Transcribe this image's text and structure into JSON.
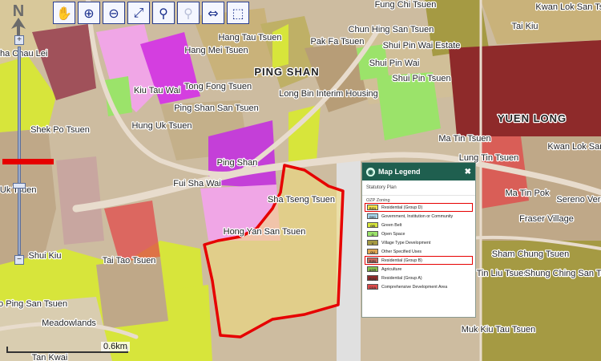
{
  "map": {
    "labels": [
      "Sha Chau Lei",
      "Shek Po Tsuen",
      "Lee Uk Tsuen",
      "Kiu Tau Wai",
      "Hung Uk Tsuen",
      "Hang Mei Tsuen",
      "Hang Tau Tsuen",
      "Pak Fa Tsuen",
      "PING SHAN",
      "Tong Fong Tsuen",
      "Ping Shan San Tsuen",
      "Long Bin Interim Housing",
      "Ping Shan",
      "Fui Sha Wai",
      "Sha Tseng Tsuen",
      "Hong Yan San Tsuen",
      "Tai Tao Tsuen",
      "Shui Kiu",
      "Wo Ping San Tsuen",
      "Meadowlands",
      "Tan Kwai",
      "Fung Chi Tsuen",
      "Chun Hing San Tsuen",
      "Shui Pin Wai Estate",
      "Tai Kiu",
      "Kwan Lok San Tsuen",
      "Shui Pin Wai",
      "Shui Pin Tsuen",
      "YUEN LONG",
      "Kwan Lok San Tsuen",
      "Ma Tin Tsuen",
      "Lung Tin Tsuen",
      "Ma Tin Pok",
      "Sereno Verde",
      "Fraser Village",
      "Sham Chung Tsuen",
      "Tin Liu Tsuen",
      "Shung Ching San Tsuen",
      "Muk Kiu Tau Tsuen"
    ],
    "scale_label": "0.6km",
    "north_label": "N",
    "zoom_plus": "+",
    "zoom_minus": "−"
  },
  "toolbar": {
    "tools": [
      "pan-icon",
      "zoom-in-icon",
      "zoom-out-icon",
      "full-extent-icon",
      "identify-icon",
      "magnify-icon",
      "swipe-icon",
      "select-icon"
    ],
    "glyphs": [
      "✋",
      "⊕",
      "⊖",
      "⤢",
      "⚲",
      "⚲",
      "⇔",
      "⬚"
    ]
  },
  "legend": {
    "title": "Map Legend",
    "close": "✖",
    "subtitle": "Statutory Plan",
    "category": "OZP Zoning",
    "items": [
      {
        "code": "R(D)",
        "label": "Residential (Group D)",
        "color": "#f7e34a",
        "highlighted": true
      },
      {
        "code": "G/IC",
        "label": "Government, Institution or Community",
        "color": "#a9d7ee",
        "highlighted": false
      },
      {
        "code": "GB",
        "label": "Green Belt",
        "color": "#d7e53b",
        "highlighted": false
      },
      {
        "code": "O",
        "label": "Open Space",
        "color": "#9be36a",
        "highlighted": false
      },
      {
        "code": "V",
        "label": "Village Type Development",
        "color": "#a59a43",
        "highlighted": false
      },
      {
        "code": "OU",
        "label": "Other Specified Uses",
        "color": "#e0a64f",
        "highlighted": false
      },
      {
        "code": "R(B)",
        "label": "Residential (Group B)",
        "color": "#c96b5c",
        "highlighted": true
      },
      {
        "code": "AGR",
        "label": "Agriculture",
        "color": "#86c14a",
        "highlighted": false
      },
      {
        "code": "R(A)",
        "label": "Residential (Group A)",
        "color": "#8e2a2a",
        "highlighted": false
      },
      {
        "code": "CDA",
        "label": "Comprehensive Development Area",
        "color": "#e04b4b",
        "highlighted": false
      }
    ]
  }
}
